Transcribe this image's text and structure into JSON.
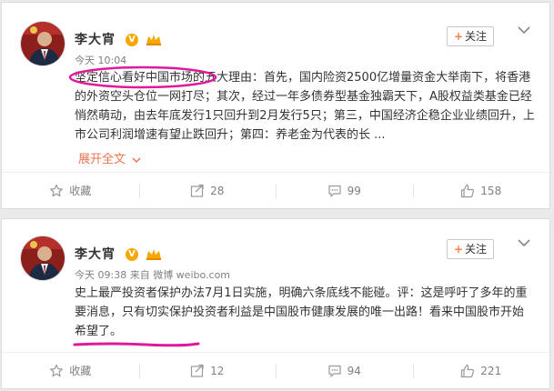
{
  "posts": [
    {
      "author": "李大宵",
      "verified_badge": "V",
      "follow_label": "关注",
      "follow_plus": "+",
      "meta": "今天 10:04",
      "text": "坚定信心看好中国市场的五大理由：首先，国内险资2500亿增量资金大举南下，将香港的外资空头仓位一网打尽；其次，经过一年多债券型基金独霸天下，A股权益类基金已经悄然萌动，由去年底发行1只回升到2月发行5只；第三，中国经济企稳企业业绩回升，上市公司利润增速有望止跌回升；第四：养老金为代表的长 ...",
      "expand_label": "展开全文",
      "actions": [
        {
          "label": "收藏",
          "icon": "star-icon"
        },
        {
          "label": "28",
          "icon": "share-icon"
        },
        {
          "label": "99",
          "icon": "comment-icon"
        },
        {
          "label": "158",
          "icon": "like-icon"
        }
      ]
    },
    {
      "author": "李大宵",
      "verified_badge": "V",
      "follow_label": "关注",
      "follow_plus": "+",
      "meta": "今天 09:38 来自 微博 weibo.com",
      "text": "史上最严投资者保护办法7月1日实施，明确六条底线不能碰。评：这是呼吁了多年的重要消息，只有切实保护投资者利益是中国股市健康发展的唯一出路！看来中国股市开始希望了。",
      "actions": [
        {
          "label": "收藏",
          "icon": "star-icon"
        },
        {
          "label": "12",
          "icon": "share-icon"
        },
        {
          "label": "94",
          "icon": "comment-icon"
        },
        {
          "label": "221",
          "icon": "like-icon"
        }
      ]
    }
  ],
  "colors": {
    "accent": "#eb7350",
    "highlight": "#e0189a",
    "badge": "#f6a700"
  }
}
